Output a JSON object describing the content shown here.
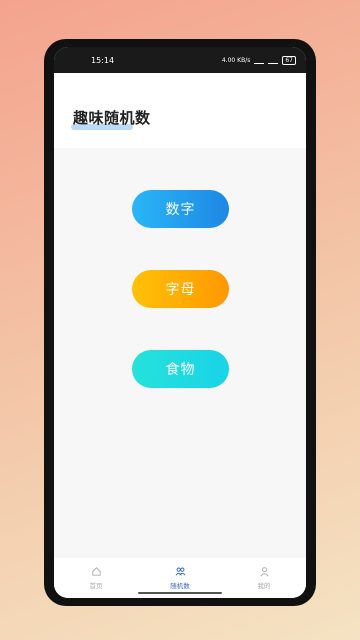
{
  "status": {
    "time": "15:14",
    "speed": "4.00 KB/s",
    "battery": "67"
  },
  "header": {
    "title": "趣味随机数"
  },
  "buttons": [
    {
      "label": "数字",
      "color": "#1e88e5"
    },
    {
      "label": "字母",
      "color": "#ff9800"
    },
    {
      "label": "食物",
      "color": "#19d3e8"
    }
  ],
  "tabs": [
    {
      "label": "首页",
      "icon": "home-icon",
      "active": false
    },
    {
      "label": "随机数",
      "icon": "people-icon",
      "active": true
    },
    {
      "label": "我的",
      "icon": "user-icon",
      "active": false
    }
  ],
  "colors": {
    "accent": "#3b6bb5"
  }
}
